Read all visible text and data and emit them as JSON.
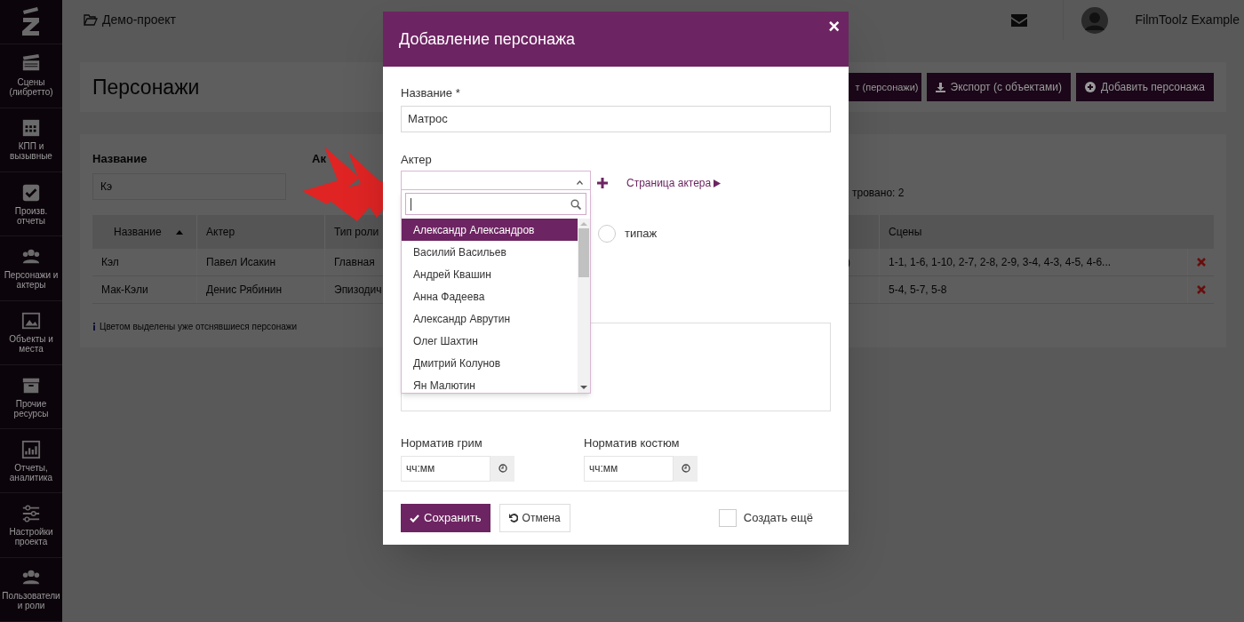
{
  "sidebar": {
    "items": [
      {
        "label": "Сцены (либретто)"
      },
      {
        "label": "КПП и вызывные"
      },
      {
        "label": "Произв. отчеты"
      },
      {
        "label": "Персонажи и актеры"
      },
      {
        "label": "Объекты и места"
      },
      {
        "label": "Прочие ресурсы"
      },
      {
        "label": "Отчеты, аналитика"
      },
      {
        "label": "Настройки проекта"
      },
      {
        "label": "Пользователи и роли"
      }
    ]
  },
  "topbar": {
    "project": "Демо-проект",
    "user": "FilmToolz Example"
  },
  "page": {
    "title": "Персонажи",
    "buttons": [
      "т (персонажи)",
      "Экспорт (с объектами)",
      "Добавить персонажа"
    ],
    "filters": [
      {
        "label": "Название",
        "value": "Кэ"
      },
      {
        "label": "Ак"
      }
    ],
    "filtered": "тровано: 2",
    "table": {
      "columns": [
        "Название",
        "Актер",
        "Тип роли",
        "",
        "Сцены"
      ],
      "rows": [
        [
          "Кэл",
          "Павел Исакин",
          "Главная",
          ")",
          "1-1, 1-6, 1-10, 2-7, 2-8, 2-9, 3-4, 4-3, 4-5, 4-6..."
        ],
        [
          "Мак-Кэли",
          "Денис Рябинин",
          "Эпизодич",
          "",
          "5-4, 5-7, 5-8"
        ]
      ]
    },
    "note": "Цветом выделены уже отснявшиеся персонажи"
  },
  "modal": {
    "title": "Добавление персонажа",
    "close": "×",
    "name_label": "Название *",
    "name_value": "Матрос",
    "actor_label": "Актер",
    "actor_link": "Страница актера",
    "actor_options": [
      {
        "label": "Александр Александров",
        "selected": true
      },
      {
        "label": "Василий Васильев",
        "selected": false
      },
      {
        "label": "Андрей Квашин",
        "selected": false
      },
      {
        "label": "Анна Фадеева",
        "selected": false
      },
      {
        "label": "Александр Аврутин",
        "selected": false
      },
      {
        "label": "Олег Шахтин",
        "selected": false
      },
      {
        "label": "Дмитрий Колунов",
        "selected": false
      },
      {
        "label": "Ян Малютин",
        "selected": false
      }
    ],
    "radio": {
      "label": "типаж",
      "selected": false
    },
    "times": [
      {
        "label": "Норматив грим",
        "placeholder": "чч:мм"
      },
      {
        "label": "Норматив костюм",
        "placeholder": "чч:мм"
      }
    ],
    "save": "Сохранить",
    "cancel": "Отмена",
    "create_more": {
      "label": "Создать ещё",
      "checked": false
    }
  }
}
